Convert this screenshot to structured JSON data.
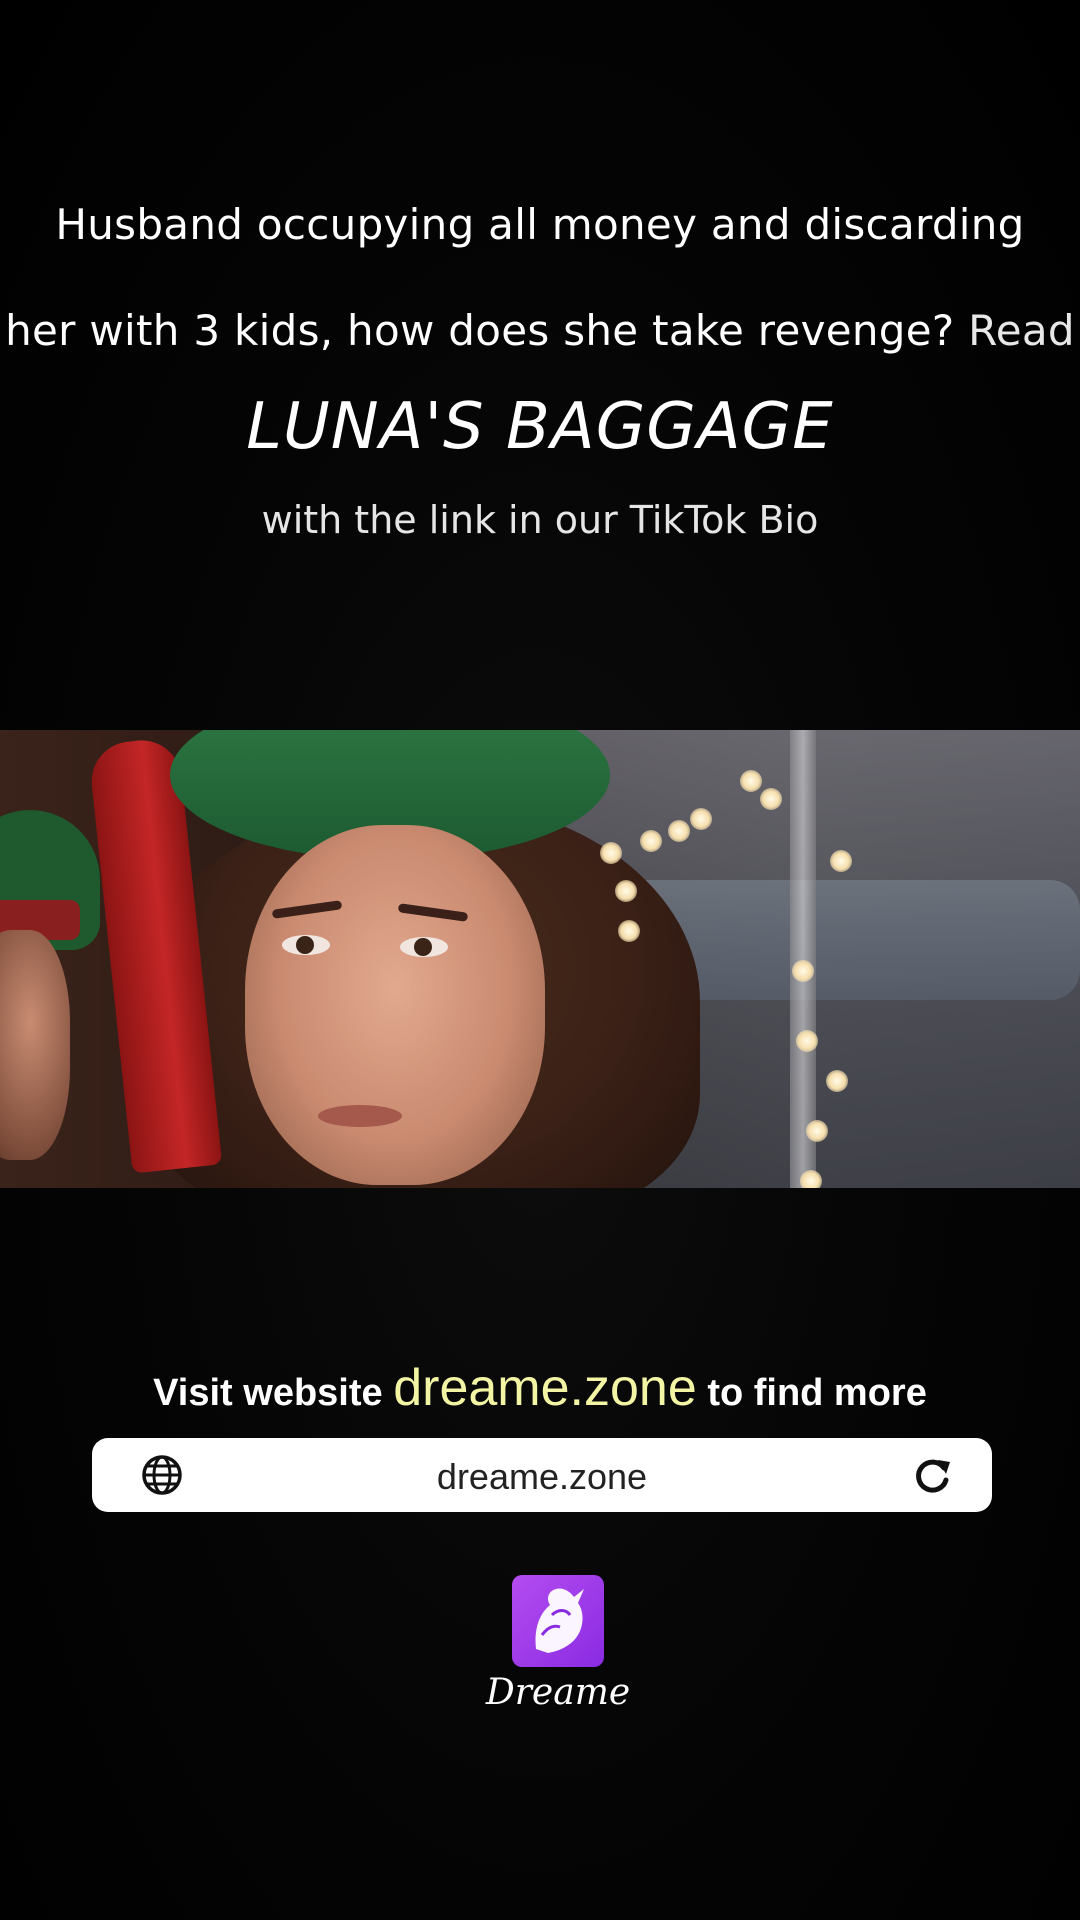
{
  "headline": {
    "line1": "Husband occupying all money and discarding",
    "line2": "her with 3 kids, how does she take revenge?",
    "read_label": "Read",
    "title": "LUNA'S BAGGAGE",
    "subline": "with the link in our TikTok Bio"
  },
  "video": {
    "description_icon": "video-frame"
  },
  "promo": {
    "prefix": "Visit website",
    "domain": "dreame.zone",
    "suffix": "to find more"
  },
  "url_bar": {
    "url": "dreame.zone",
    "left_icon": "globe-icon",
    "right_icon": "reload-icon"
  },
  "brand": {
    "name": "Dreame",
    "logo_icon": "unicorn-logo-icon",
    "accent_color": "#9b3df0"
  },
  "colors": {
    "background": "#000000",
    "domain_highlight": "#f3f5a4",
    "text": "#ffffff"
  }
}
